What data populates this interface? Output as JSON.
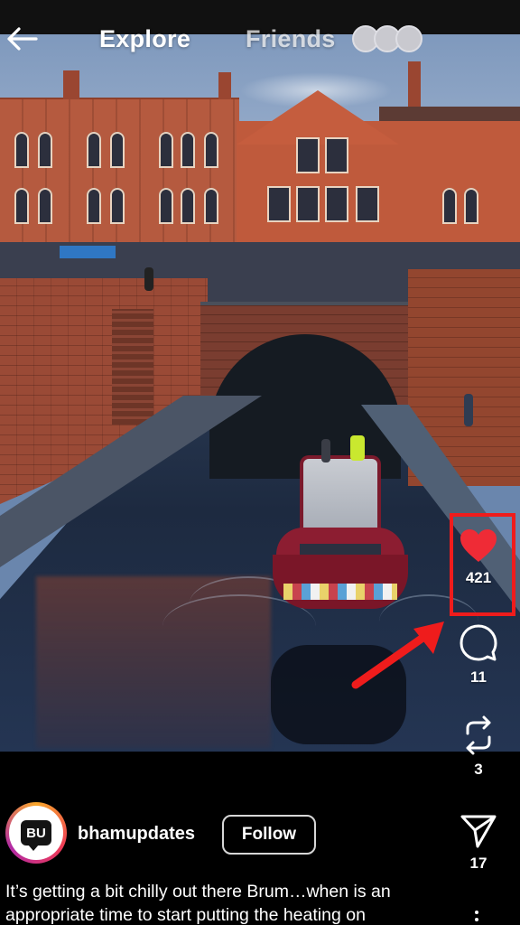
{
  "topbar": {
    "tabs": [
      "Explore",
      "Friends"
    ],
    "active_tab": "Explore",
    "back_icon": "arrow-left-icon"
  },
  "actions": {
    "likes": "421",
    "comments": "11",
    "reposts": "3",
    "shares": "17",
    "liked": true
  },
  "post": {
    "username": "bhamupdates",
    "avatar_text": "BU",
    "follow_label": "Follow",
    "caption": "It’s getting a bit chilly out there Brum…when is an appropriate time to start putting the heating on"
  },
  "colors": {
    "like_red": "#ef2b36",
    "highlight_red": "#ef1c1c",
    "background": "#000000",
    "text": "#ffffff"
  }
}
